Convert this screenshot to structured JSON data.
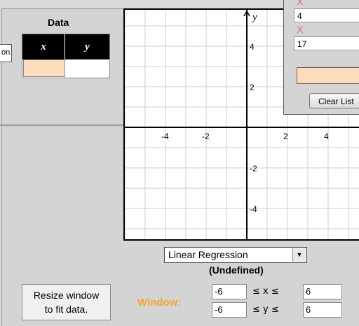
{
  "left_stub": {
    "text": "on"
  },
  "data_panel": {
    "title": "Data",
    "col_x": "x",
    "col_y": "y"
  },
  "graph": {
    "axis_y_label": "y",
    "x_ticks": [
      "-4",
      "-2",
      "2",
      "4"
    ],
    "y_ticks": [
      "4",
      "2",
      "-2",
      "-4"
    ]
  },
  "popup": {
    "x_mark_1": "X",
    "value_1": "4",
    "x_mark_2": "X",
    "value_2": "17",
    "clear_button": "Clear List"
  },
  "regression": {
    "selected": "Linear Regression",
    "result": "(Undefined)"
  },
  "resize_button": {
    "line1": "Resize window",
    "line2": "to fit data."
  },
  "window": {
    "label": "Window:",
    "x_min": "-6",
    "x_max": "6",
    "y_min": "-6",
    "y_max": "6",
    "x_rel": "≤ x ≤",
    "y_rel": "≤ y ≤"
  },
  "colors": {
    "accent_orange": "#f4a531",
    "input_peach": "#fddcbc",
    "x_mark_red": "#e46b6b"
  }
}
